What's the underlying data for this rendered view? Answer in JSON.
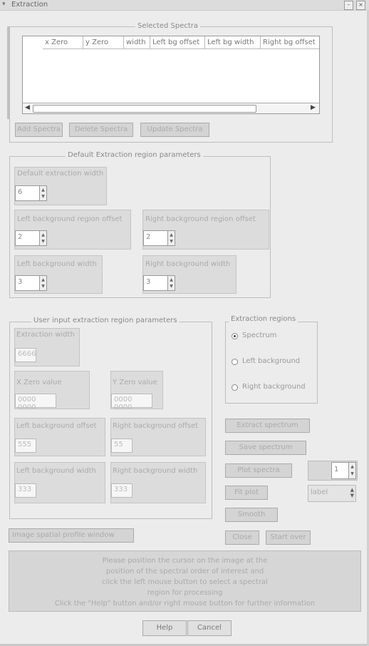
{
  "window": {
    "title": "Extraction"
  },
  "selected_spectra": {
    "group_label": "Selected Spectra",
    "columns": [
      "x Zero",
      "y Zero",
      "width",
      "Left bg offset",
      "Left bg width",
      "Right bg offset"
    ],
    "buttons": {
      "add": "Add Spectra",
      "delete": "Delete Spectra",
      "update": "Update Spectra"
    }
  },
  "default_params": {
    "group_label": "Default Extraction region parameters",
    "fields": {
      "extraction_width": {
        "label": "Default extraction width",
        "value": "6"
      },
      "left_bg_offset": {
        "label": "Left background region offset",
        "value": "2"
      },
      "right_bg_offset": {
        "label": "Right background region offset",
        "value": "2"
      },
      "left_bg_width": {
        "label": "Left background width",
        "value": "3"
      },
      "right_bg_width": {
        "label": "Right background width",
        "value": "3"
      }
    }
  },
  "user_params": {
    "group_label": "User input extraction region parameters",
    "fields": {
      "extraction_width": {
        "label": "Extraction width",
        "value": "6666"
      },
      "x_zero": {
        "label": "X Zero value",
        "value": "0000 0000"
      },
      "y_zero": {
        "label": "Y Zero value",
        "value": "0000 0000"
      },
      "left_bg_offset": {
        "label": "Left background offset",
        "value": "555"
      },
      "right_bg_offset": {
        "label": "Right background offset",
        "value": "55"
      },
      "left_bg_width": {
        "label": "Left background width",
        "value": "333"
      },
      "right_bg_width": {
        "label": "Right background width",
        "value": "333"
      }
    }
  },
  "extraction_regions": {
    "group_label": "Extraction regions",
    "options": [
      "Spectrum",
      "Left background",
      "Right background"
    ],
    "selected": "Spectrum"
  },
  "actions": {
    "extract": "Extract spectrum",
    "save": "Save spectrum",
    "plot_spectra": "Plot spectra",
    "plot_spin_value": "1",
    "fit": "Fit plot",
    "fit_combo_value": "label",
    "smooth": "Smooth",
    "image_label": "Image spatial profile window",
    "close": "Close",
    "start_over": "Start over",
    "help": "Help",
    "cancel": "Cancel"
  },
  "help_text": [
    "Please position the cursor on the image at the",
    "position of the spectral order of interest and",
    "click the left mouse button to select a spectral",
    "region for processing",
    "Click the \"Help\" button and/or right mouse button for further information"
  ]
}
